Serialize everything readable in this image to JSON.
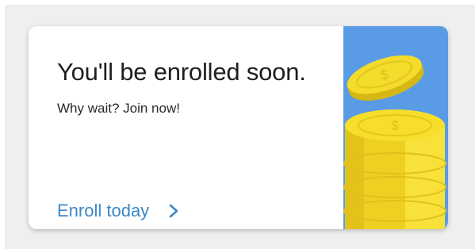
{
  "promo": {
    "headline": "You'll be enrolled soon.",
    "subhead": "Why wait? Join now!",
    "cta_label": "Enroll today",
    "cta_icon": "chevron-right-icon",
    "art_icon": "gold-coins-icon"
  },
  "colors": {
    "page_background": "#efefef",
    "card_background": "#ffffff",
    "link_blue": "#3b87c8",
    "art_panel_blue": "#5a9be6",
    "coin_gold": "#f4dc2a"
  }
}
